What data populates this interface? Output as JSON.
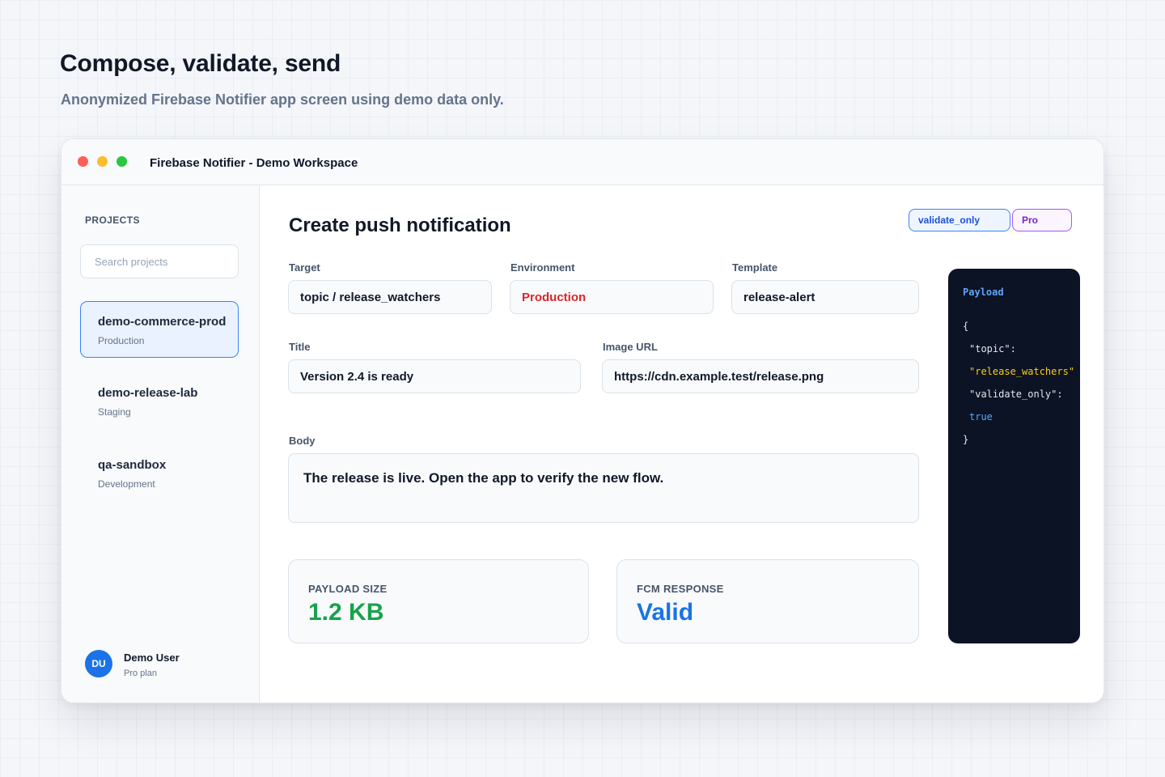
{
  "page": {
    "title": "Compose, validate, send",
    "subtitle": "Anonymized Firebase Notifier app screen using demo data only."
  },
  "window": {
    "title": "Firebase Notifier - Demo Workspace"
  },
  "sidebar": {
    "heading": "PROJECTS",
    "search_placeholder": "Search projects",
    "projects": [
      {
        "name": "demo-commerce-prod",
        "env": "Production",
        "active": true
      },
      {
        "name": "demo-release-lab",
        "env": "Staging",
        "active": false
      },
      {
        "name": "qa-sandbox",
        "env": "Development",
        "active": false
      }
    ],
    "user": {
      "initials": "DU",
      "name": "Demo User",
      "plan": "Pro plan"
    }
  },
  "main": {
    "title": "Create push notification",
    "badges": {
      "validate": "validate_only",
      "pro": "Pro"
    },
    "fields": {
      "target": {
        "label": "Target",
        "value": "topic / release_watchers"
      },
      "environment": {
        "label": "Environment",
        "value": "Production"
      },
      "template": {
        "label": "Template",
        "value": "release-alert"
      },
      "title": {
        "label": "Title",
        "value": "Version 2.4 is ready"
      },
      "image_url": {
        "label": "Image URL",
        "value": "https://cdn.example.test/release.png"
      },
      "body": {
        "label": "Body",
        "value": "The release is live. Open the app to verify the new flow."
      }
    },
    "stats": {
      "payload_size": {
        "label": "PAYLOAD SIZE",
        "value": "1.2 KB"
      },
      "fcm_response": {
        "label": "FCM RESPONSE",
        "value": "Valid"
      }
    }
  },
  "payload": {
    "title": "Payload",
    "lines": [
      "{",
      "\"topic\":",
      "\"release_watchers\"",
      "\"validate_only\":",
      "true",
      "}"
    ]
  },
  "colors": {
    "accent": "#1a73e8",
    "environment_text": "#dc2626",
    "payload_size_value": "#16a34a",
    "fcm_response_value": "#1a73e8",
    "code_background": "#0b1324"
  }
}
